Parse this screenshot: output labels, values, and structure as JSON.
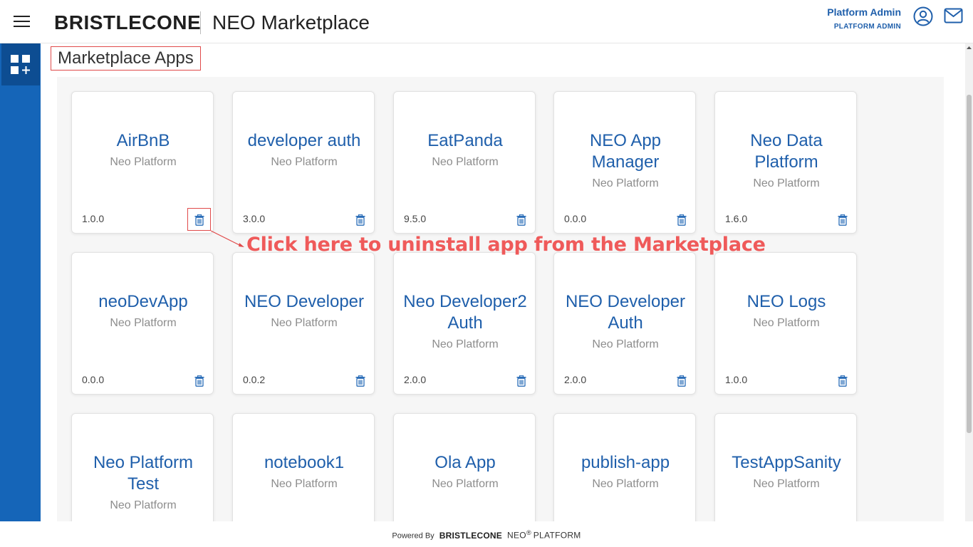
{
  "header": {
    "logo_text": "BRISTLECONE",
    "app_title": "NEO Marketplace",
    "user_name": "Platform Admin",
    "user_role": "PLATFORM ADMIN"
  },
  "page": {
    "title": "Marketplace Apps"
  },
  "apps": [
    {
      "name": "AirBnB",
      "publisher": "Neo Platform",
      "version": "1.0.0"
    },
    {
      "name": "developer auth",
      "publisher": "Neo Platform",
      "version": "3.0.0"
    },
    {
      "name": "EatPanda",
      "publisher": "Neo Platform",
      "version": "9.5.0"
    },
    {
      "name": "NEO App Manager",
      "publisher": "Neo Platform",
      "version": "0.0.0"
    },
    {
      "name": "Neo Data Platform",
      "publisher": "Neo Platform",
      "version": "1.6.0"
    },
    {
      "name": "neoDevApp",
      "publisher": "Neo Platform",
      "version": "0.0.0"
    },
    {
      "name": "NEO Developer",
      "publisher": "Neo Platform",
      "version": "0.0.2"
    },
    {
      "name": "Neo Developer2 Auth",
      "publisher": "Neo Platform",
      "version": "2.0.0"
    },
    {
      "name": "NEO Developer Auth",
      "publisher": "Neo Platform",
      "version": "2.0.0"
    },
    {
      "name": "NEO Logs",
      "publisher": "Neo Platform",
      "version": "1.0.0"
    },
    {
      "name": "Neo Platform Test",
      "publisher": "Neo Platform",
      "version": ""
    },
    {
      "name": "notebook1",
      "publisher": "Neo Platform",
      "version": ""
    },
    {
      "name": "Ola App",
      "publisher": "Neo Platform",
      "version": ""
    },
    {
      "name": "publish-app",
      "publisher": "Neo Platform",
      "version": ""
    },
    {
      "name": "TestAppSanity",
      "publisher": "Neo Platform",
      "version": ""
    }
  ],
  "annotation": {
    "text": "Click here to uninstall app from the Marketplace"
  },
  "footer": {
    "powered_by": "Powered By",
    "brand": "BRISTLECONE",
    "product": "NEO",
    "registered": "®",
    "platform": "PLATFORM"
  },
  "colors": {
    "sidebar": "#1565b8",
    "accent": "#1f5fab",
    "annotation": "#ef5a5a"
  }
}
